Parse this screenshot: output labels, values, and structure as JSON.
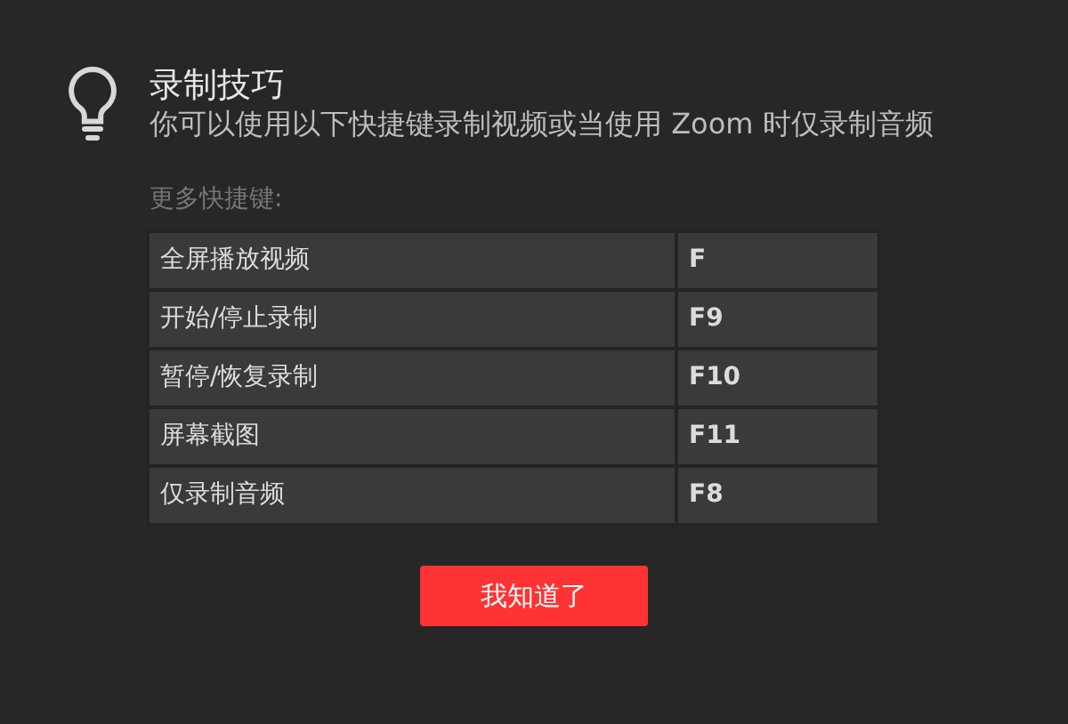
{
  "tip": {
    "title": "录制技巧",
    "description": "你可以使用以下快捷键录制视频或当使用 Zoom 时仅录制音频"
  },
  "shortcuts_label": "更多快捷键:",
  "shortcuts": [
    {
      "action": "全屏播放视频",
      "key": "F"
    },
    {
      "action": "开始/停止录制",
      "key": "F9"
    },
    {
      "action": "暂停/恢复录制",
      "key": "F10"
    },
    {
      "action": "屏幕截图",
      "key": "F11"
    },
    {
      "action": "仅录制音频",
      "key": "F8"
    }
  ],
  "button": "我知道了"
}
